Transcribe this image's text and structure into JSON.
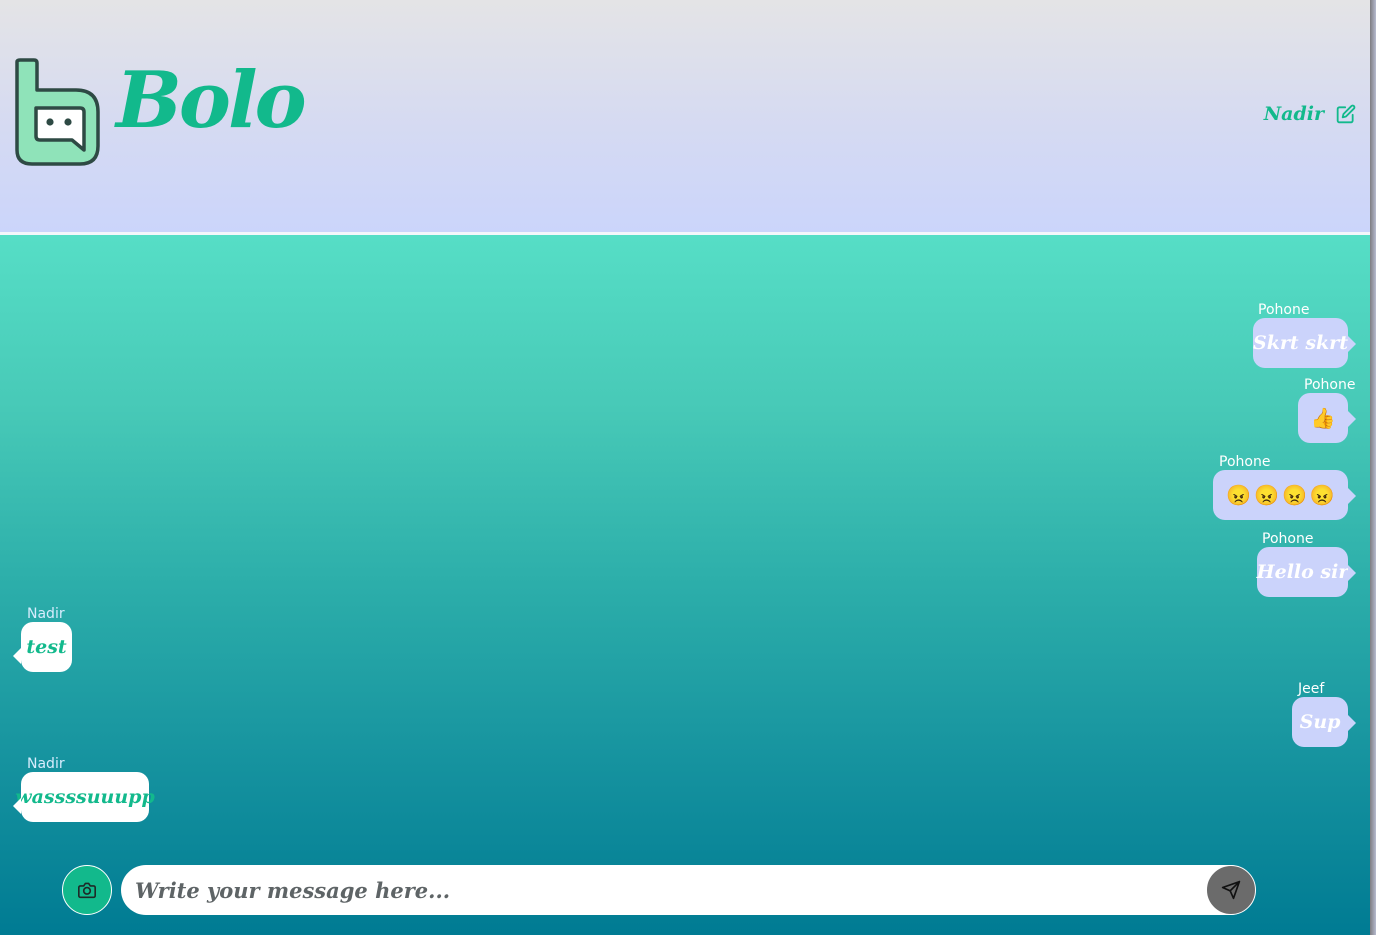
{
  "brand": {
    "name": "Bolo",
    "logo_icon": "bolo-chat-logo-icon"
  },
  "header": {
    "username": "Nadir",
    "edit_icon": "edit-icon"
  },
  "messages": [
    {
      "sender": "Pohone",
      "text": "Skrt skrt",
      "side": "right"
    },
    {
      "sender": "Pohone",
      "emoji": [
        "👍"
      ],
      "side": "right"
    },
    {
      "sender": "Pohone",
      "emoji": [
        "😠",
        "😠",
        "😠",
        "😠"
      ],
      "side": "right"
    },
    {
      "sender": "Pohone",
      "text": "Hello sir",
      "side": "right"
    },
    {
      "sender": "Nadir",
      "text": "test",
      "side": "left"
    },
    {
      "sender": "Jeef",
      "text": "Sup",
      "side": "right"
    },
    {
      "sender": "Nadir",
      "text": "wassssuuupp",
      "side": "left"
    }
  ],
  "composer": {
    "placeholder": "Write your message here...",
    "camera_icon": "camera-icon",
    "send_icon": "send-icon"
  },
  "colors": {
    "brand_green": "#12b98c",
    "outgoing_bubble": "#cbd3fb",
    "incoming_bubble": "#ffffff",
    "send_button": "#6b6b6b"
  }
}
